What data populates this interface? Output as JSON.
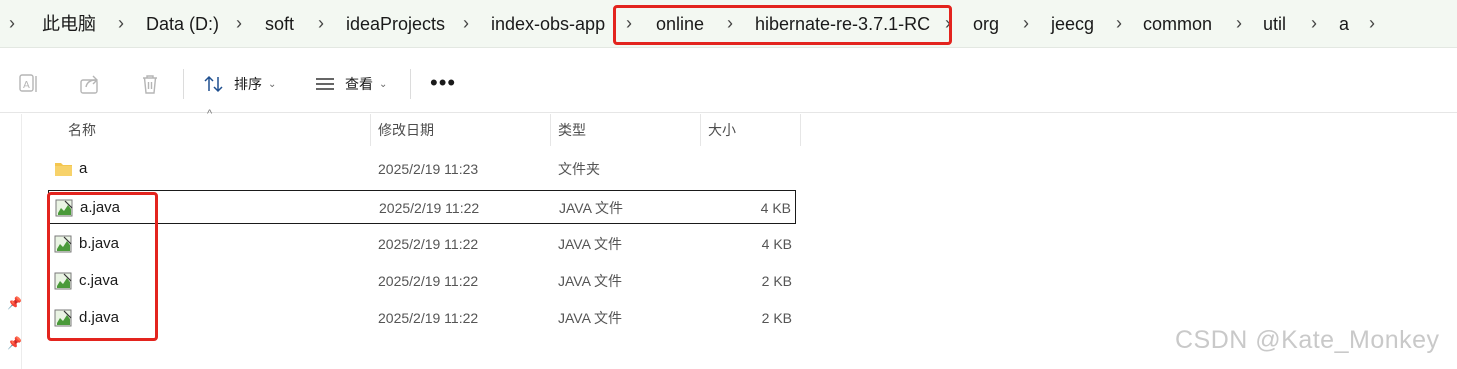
{
  "breadcrumb": {
    "items": [
      "此电脑",
      "Data (D:)",
      "soft",
      "ideaProjects",
      "index-obs-app",
      "online",
      "hibernate-re-3.7.1-RC",
      "org",
      "jeecg",
      "common",
      "util",
      "a"
    ]
  },
  "toolbar": {
    "sort_label": "排序",
    "view_label": "查看",
    "more_label": "•••"
  },
  "columns": {
    "name": "名称",
    "modified": "修改日期",
    "type": "类型",
    "size": "大小"
  },
  "rows": [
    {
      "name": "a",
      "modified": "2025/2/19 11:23",
      "type": "文件夹",
      "size": "",
      "icon": "folder-icon"
    },
    {
      "name": "a.java",
      "modified": "2025/2/19 11:22",
      "type": "JAVA 文件",
      "size": "4 KB",
      "icon": "java-file-icon"
    },
    {
      "name": "b.java",
      "modified": "2025/2/19 11:22",
      "type": "JAVA 文件",
      "size": "4 KB",
      "icon": "java-file-icon"
    },
    {
      "name": "c.java",
      "modified": "2025/2/19 11:22",
      "type": "JAVA 文件",
      "size": "2 KB",
      "icon": "java-file-icon"
    },
    {
      "name": "d.java",
      "modified": "2025/2/19 11:22",
      "type": "JAVA 文件",
      "size": "2 KB",
      "icon": "java-file-icon"
    }
  ],
  "watermark": "CSDN @Kate_Monkey",
  "colors": {
    "breadcrumb_bg": "#f3f8f2",
    "highlight": "#e3241e",
    "folder": "#f4c64f",
    "java_icon": "#4a9a3a"
  }
}
